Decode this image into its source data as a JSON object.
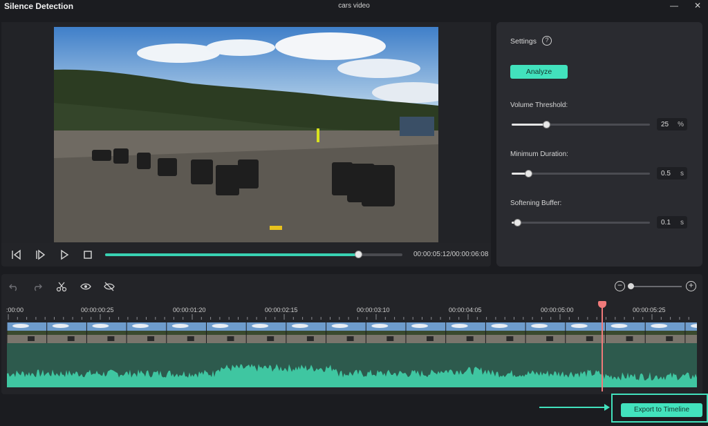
{
  "window": {
    "app_title": "Silence Detection",
    "document_title": "cars video",
    "minimize_icon": "minimize-icon",
    "close_icon": "close-icon"
  },
  "player": {
    "timecode": "00:00:05:12/00:00:06:08",
    "progress_fraction": 0.85,
    "controls": [
      "previous-frame-icon",
      "next-frame-icon",
      "play-icon",
      "stop-icon"
    ]
  },
  "settings": {
    "title": "Settings",
    "help_icon": "help-icon",
    "analyze_label": "Analyze",
    "params": [
      {
        "label": "Volume Threshold:",
        "value": "25",
        "unit": "%",
        "fraction": 0.25
      },
      {
        "label": "Minimum Duration:",
        "value": "0.5",
        "unit": "s",
        "fraction": 0.12
      },
      {
        "label": "Softening Buffer:",
        "value": "0.1",
        "unit": "s",
        "fraction": 0.04
      }
    ]
  },
  "timeline": {
    "tools": [
      "undo-icon",
      "redo-icon",
      "scissors-icon",
      "eye-icon",
      "eye-off-icon"
    ],
    "zoom_out_icon": "zoom-out-icon",
    "zoom_in_icon": "zoom-in-icon",
    "ruler_labels": [
      ":00:00",
      "00:00:00:25",
      "00:00:01:20",
      "00:00:02:15",
      "00:00:03:10",
      "00:00:04:05",
      "00:00:05:00",
      "00:00:05:25"
    ],
    "playhead_position": "00:00:05:12"
  },
  "export_label": "Export to Timeline",
  "colors": {
    "accent": "#42e2bd",
    "playhead": "#f07a7a",
    "panel": "#232428"
  }
}
